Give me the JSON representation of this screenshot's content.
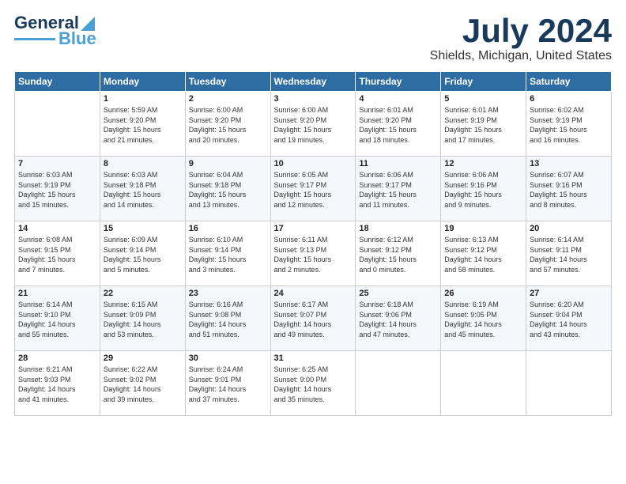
{
  "header": {
    "logo": {
      "line1": "General",
      "line2": "Blue"
    },
    "title": "July 2024",
    "subtitle": "Shields, Michigan, United States"
  },
  "weekdays": [
    "Sunday",
    "Monday",
    "Tuesday",
    "Wednesday",
    "Thursday",
    "Friday",
    "Saturday"
  ],
  "weeks": [
    [
      {
        "day": "",
        "content": ""
      },
      {
        "day": "1",
        "content": "Sunrise: 5:59 AM\nSunset: 9:20 PM\nDaylight: 15 hours\nand 21 minutes."
      },
      {
        "day": "2",
        "content": "Sunrise: 6:00 AM\nSunset: 9:20 PM\nDaylight: 15 hours\nand 20 minutes."
      },
      {
        "day": "3",
        "content": "Sunrise: 6:00 AM\nSunset: 9:20 PM\nDaylight: 15 hours\nand 19 minutes."
      },
      {
        "day": "4",
        "content": "Sunrise: 6:01 AM\nSunset: 9:20 PM\nDaylight: 15 hours\nand 18 minutes."
      },
      {
        "day": "5",
        "content": "Sunrise: 6:01 AM\nSunset: 9:19 PM\nDaylight: 15 hours\nand 17 minutes."
      },
      {
        "day": "6",
        "content": "Sunrise: 6:02 AM\nSunset: 9:19 PM\nDaylight: 15 hours\nand 16 minutes."
      }
    ],
    [
      {
        "day": "7",
        "content": "Sunrise: 6:03 AM\nSunset: 9:19 PM\nDaylight: 15 hours\nand 15 minutes."
      },
      {
        "day": "8",
        "content": "Sunrise: 6:03 AM\nSunset: 9:18 PM\nDaylight: 15 hours\nand 14 minutes."
      },
      {
        "day": "9",
        "content": "Sunrise: 6:04 AM\nSunset: 9:18 PM\nDaylight: 15 hours\nand 13 minutes."
      },
      {
        "day": "10",
        "content": "Sunrise: 6:05 AM\nSunset: 9:17 PM\nDaylight: 15 hours\nand 12 minutes."
      },
      {
        "day": "11",
        "content": "Sunrise: 6:06 AM\nSunset: 9:17 PM\nDaylight: 15 hours\nand 11 minutes."
      },
      {
        "day": "12",
        "content": "Sunrise: 6:06 AM\nSunset: 9:16 PM\nDaylight: 15 hours\nand 9 minutes."
      },
      {
        "day": "13",
        "content": "Sunrise: 6:07 AM\nSunset: 9:16 PM\nDaylight: 15 hours\nand 8 minutes."
      }
    ],
    [
      {
        "day": "14",
        "content": "Sunrise: 6:08 AM\nSunset: 9:15 PM\nDaylight: 15 hours\nand 7 minutes."
      },
      {
        "day": "15",
        "content": "Sunrise: 6:09 AM\nSunset: 9:14 PM\nDaylight: 15 hours\nand 5 minutes."
      },
      {
        "day": "16",
        "content": "Sunrise: 6:10 AM\nSunset: 9:14 PM\nDaylight: 15 hours\nand 3 minutes."
      },
      {
        "day": "17",
        "content": "Sunrise: 6:11 AM\nSunset: 9:13 PM\nDaylight: 15 hours\nand 2 minutes."
      },
      {
        "day": "18",
        "content": "Sunrise: 6:12 AM\nSunset: 9:12 PM\nDaylight: 15 hours\nand 0 minutes."
      },
      {
        "day": "19",
        "content": "Sunrise: 6:13 AM\nSunset: 9:12 PM\nDaylight: 14 hours\nand 58 minutes."
      },
      {
        "day": "20",
        "content": "Sunrise: 6:14 AM\nSunset: 9:11 PM\nDaylight: 14 hours\nand 57 minutes."
      }
    ],
    [
      {
        "day": "21",
        "content": "Sunrise: 6:14 AM\nSunset: 9:10 PM\nDaylight: 14 hours\nand 55 minutes."
      },
      {
        "day": "22",
        "content": "Sunrise: 6:15 AM\nSunset: 9:09 PM\nDaylight: 14 hours\nand 53 minutes."
      },
      {
        "day": "23",
        "content": "Sunrise: 6:16 AM\nSunset: 9:08 PM\nDaylight: 14 hours\nand 51 minutes."
      },
      {
        "day": "24",
        "content": "Sunrise: 6:17 AM\nSunset: 9:07 PM\nDaylight: 14 hours\nand 49 minutes."
      },
      {
        "day": "25",
        "content": "Sunrise: 6:18 AM\nSunset: 9:06 PM\nDaylight: 14 hours\nand 47 minutes."
      },
      {
        "day": "26",
        "content": "Sunrise: 6:19 AM\nSunset: 9:05 PM\nDaylight: 14 hours\nand 45 minutes."
      },
      {
        "day": "27",
        "content": "Sunrise: 6:20 AM\nSunset: 9:04 PM\nDaylight: 14 hours\nand 43 minutes."
      }
    ],
    [
      {
        "day": "28",
        "content": "Sunrise: 6:21 AM\nSunset: 9:03 PM\nDaylight: 14 hours\nand 41 minutes."
      },
      {
        "day": "29",
        "content": "Sunrise: 6:22 AM\nSunset: 9:02 PM\nDaylight: 14 hours\nand 39 minutes."
      },
      {
        "day": "30",
        "content": "Sunrise: 6:24 AM\nSunset: 9:01 PM\nDaylight: 14 hours\nand 37 minutes."
      },
      {
        "day": "31",
        "content": "Sunrise: 6:25 AM\nSunset: 9:00 PM\nDaylight: 14 hours\nand 35 minutes."
      },
      {
        "day": "",
        "content": ""
      },
      {
        "day": "",
        "content": ""
      },
      {
        "day": "",
        "content": ""
      }
    ]
  ]
}
